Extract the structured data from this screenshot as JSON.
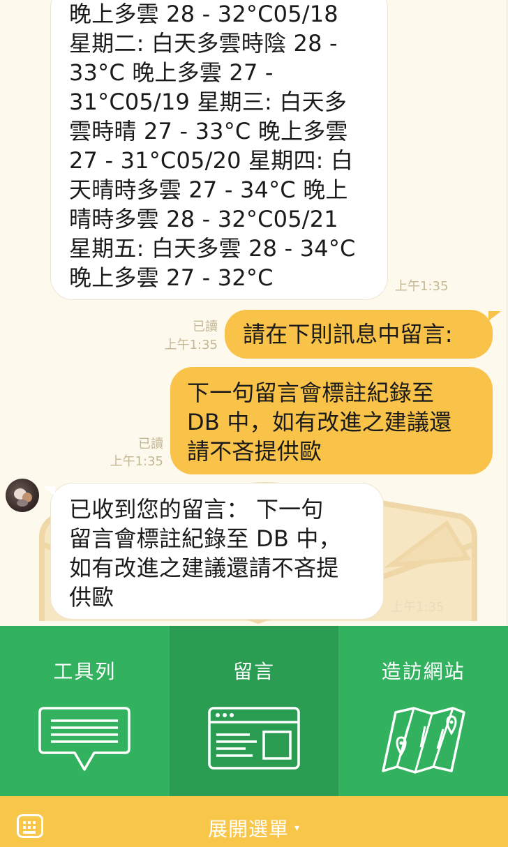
{
  "chat": {
    "messages": [
      {
        "direction": "in",
        "lines": [
          "晚上多雲 28 - 32°C05/18",
          "星期二: 白天多雲時陰 28 -",
          "33°C 晚上多雲 27 -",
          "31°C05/19 星期三: 白天多",
          "雲時晴 27 - 33°C 晚上多雲",
          "27 - 31°C05/20 星期四: 白",
          "天晴時多雲 27 - 34°C 晚上",
          "晴時多雲 28 - 32°C05/21",
          "星期五: 白天多雲 28 - 34°C",
          "晚上多雲 27 - 32°C"
        ],
        "time": "上午1:35"
      },
      {
        "direction": "out",
        "lines": [
          "請在下則訊息中留言:"
        ],
        "read": "已讀",
        "time": "上午1:35"
      },
      {
        "direction": "out",
        "lines": [
          "下一句留言會標註紀錄至",
          "DB 中，如有改進之建議還",
          "請不吝提供歐"
        ],
        "read": "已讀",
        "time": "上午1:35"
      },
      {
        "direction": "in",
        "lines": [
          "已收到您的留言： 下一句",
          "留言會標註紀錄至 DB 中，",
          "如有改進之建議還請不吝提",
          "供歐"
        ],
        "time": "上午1:35"
      }
    ]
  },
  "menu": {
    "items": [
      {
        "label": "工具列",
        "icon": "speech-bubble-list-icon"
      },
      {
        "label": "留言",
        "icon": "browser-window-icon"
      },
      {
        "label": "造訪網站",
        "icon": "folded-map-icon"
      }
    ],
    "active_index": 1
  },
  "footer": {
    "expand_label": "展開選單",
    "expand_arrow": "▾",
    "keyboard_icon": "keyboard-icon"
  },
  "colors": {
    "chat_bg": "#fdf9ec",
    "outgoing_bubble": "#f9c34a",
    "incoming_bubble": "#ffffff",
    "menu_green": "#32b15f",
    "menu_active_green": "#2a9d53",
    "footer_yellow": "#f8c648",
    "meta_text": "#c4b795"
  }
}
